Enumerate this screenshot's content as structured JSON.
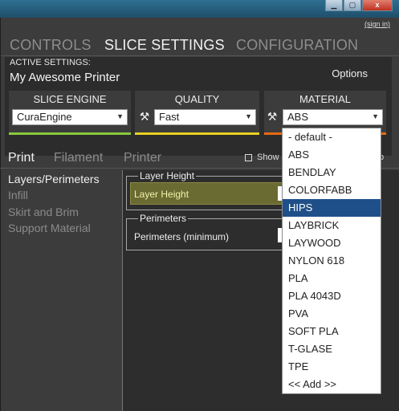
{
  "window": {
    "minimize": "▁",
    "maximize": "▢",
    "close": "x"
  },
  "header": {
    "sign_in": "(sign in)"
  },
  "main_tabs": [
    {
      "label": "CONTROLS"
    },
    {
      "label": "SLICE SETTINGS"
    },
    {
      "label": "CONFIGURATION"
    }
  ],
  "active_settings": {
    "label": "ACTIVE SETTINGS:",
    "printer_name": "My Awesome Printer",
    "options_label": "Options"
  },
  "slice_engine": {
    "header": "SLICE ENGINE",
    "value": "CuraEngine",
    "bar_color": "#8bc83c"
  },
  "quality": {
    "header": "QUALITY",
    "value": "Fast",
    "bar_color": "#e8d020"
  },
  "material": {
    "header": "MATERIAL",
    "value": "ABS",
    "bar_color": "#e86a10"
  },
  "icons": {
    "arrow": "▼",
    "tools": "⚒"
  },
  "sub_tabs": [
    {
      "label": "Print"
    },
    {
      "label": "Filament"
    },
    {
      "label": "Printer"
    }
  ],
  "show_label": "Show",
  "show_tail": "p",
  "left_nav": [
    {
      "label": "Layers/Perimeters"
    },
    {
      "label": "Infill"
    },
    {
      "label": "Skirt and Brim"
    },
    {
      "label": "Support Material"
    }
  ],
  "groups": {
    "layer_height": {
      "legend": "Layer Height",
      "row_label": "Layer Height"
    },
    "perimeters": {
      "legend": "Perimeters",
      "row_label": "Perimeters (minimum)"
    }
  },
  "material_options": [
    "- default -",
    "ABS",
    "BENDLAY",
    "COLORFABB",
    "HIPS",
    "LAYBRICK",
    "LAYWOOD",
    "NYLON 618",
    "PLA",
    "PLA 4043D",
    "PVA",
    "SOFT PLA",
    "T-GLASE",
    "TPE",
    "<< Add >>"
  ],
  "material_highlighted": "HIPS"
}
